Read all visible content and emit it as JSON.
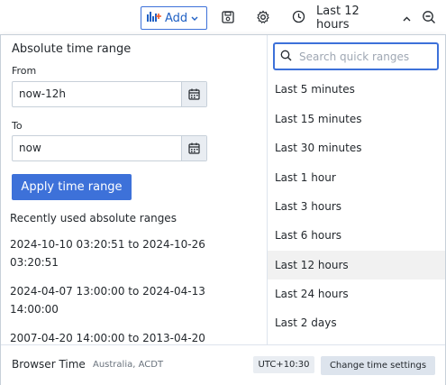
{
  "toolbar": {
    "add_label": "Add",
    "time_range_label": "Last 12 hours"
  },
  "absolute": {
    "title": "Absolute time range",
    "from_label": "From",
    "from_value": "now-12h",
    "to_label": "To",
    "to_value": "now",
    "apply_label": "Apply time range",
    "recent_title": "Recently used absolute ranges",
    "recent": [
      {
        "line1": "2024-10-10 03:20:51 to 2024-10-26",
        "line2": "03:20:51"
      },
      {
        "line1": "2024-04-07 13:00:00 to 2024-04-13",
        "line2": "14:00:00"
      },
      {
        "line1": "2007-04-20 14:00:00 to 2013-04-20",
        "line2": ""
      }
    ]
  },
  "quick": {
    "search_placeholder": "Search quick ranges",
    "items": [
      "Last 5 minutes",
      "Last 15 minutes",
      "Last 30 minutes",
      "Last 1 hour",
      "Last 3 hours",
      "Last 6 hours",
      "Last 12 hours",
      "Last 24 hours",
      "Last 2 days"
    ],
    "selected": "Last 12 hours"
  },
  "footer": {
    "browser_time": "Browser Time",
    "timezone": "Australia, ACDT",
    "utc_offset": "UTC+10:30",
    "change_settings": "Change time settings"
  },
  "colors": {
    "primary": "#3d71d9",
    "selected_bg": "#f1f1f1",
    "border": "#c7d0d9"
  },
  "icons": [
    "add-panel-icon",
    "save-icon",
    "gear-icon",
    "clock-icon",
    "chevron-up-icon",
    "zoom-out-icon",
    "calendar-icon",
    "search-icon"
  ]
}
